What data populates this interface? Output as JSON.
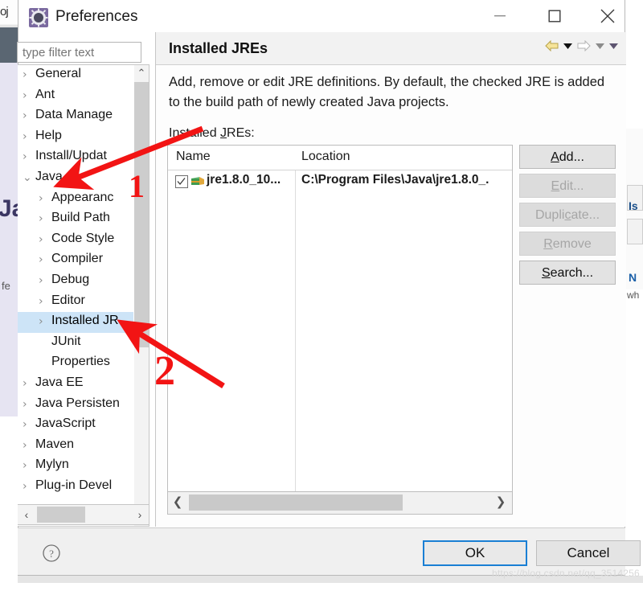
{
  "window": {
    "title": "Preferences",
    "icon": "eclipse-preferences-icon",
    "minimize_label": "Minimize",
    "maximize_label": "Maximize",
    "close_label": "Close"
  },
  "filter": {
    "placeholder": "type filter text",
    "value": ""
  },
  "tree": {
    "items": [
      {
        "label": "General",
        "level": 0,
        "arrow": "›",
        "selected": false
      },
      {
        "label": "Ant",
        "level": 0,
        "arrow": "›",
        "selected": false
      },
      {
        "label": "Data Manage",
        "level": 0,
        "arrow": "›",
        "selected": false
      },
      {
        "label": "Help",
        "level": 0,
        "arrow": "›",
        "selected": false
      },
      {
        "label": "Install/Updat",
        "level": 0,
        "arrow": "›",
        "selected": false
      },
      {
        "label": "Java",
        "level": 0,
        "arrow": "⌄",
        "selected": false
      },
      {
        "label": "Appearanc",
        "level": 1,
        "arrow": "›",
        "selected": false
      },
      {
        "label": "Build Path",
        "level": 1,
        "arrow": "›",
        "selected": false
      },
      {
        "label": "Code Style",
        "level": 1,
        "arrow": "›",
        "selected": false
      },
      {
        "label": "Compiler",
        "level": 1,
        "arrow": "›",
        "selected": false
      },
      {
        "label": "Debug",
        "level": 1,
        "arrow": "›",
        "selected": false
      },
      {
        "label": "Editor",
        "level": 1,
        "arrow": "›",
        "selected": false
      },
      {
        "label": "Installed JR",
        "level": 1,
        "arrow": "›",
        "selected": true
      },
      {
        "label": "JUnit",
        "level": 1,
        "arrow": "",
        "selected": false
      },
      {
        "label": "Properties",
        "level": 1,
        "arrow": "",
        "selected": false
      },
      {
        "label": "Java EE",
        "level": 0,
        "arrow": "›",
        "selected": false
      },
      {
        "label": "Java Persisten",
        "level": 0,
        "arrow": "›",
        "selected": false
      },
      {
        "label": "JavaScript",
        "level": 0,
        "arrow": "›",
        "selected": false
      },
      {
        "label": "Maven",
        "level": 0,
        "arrow": "›",
        "selected": false
      },
      {
        "label": "Mylyn",
        "level": 0,
        "arrow": "›",
        "selected": false
      },
      {
        "label": "Plug-in Devel",
        "level": 0,
        "arrow": "›",
        "selected": false
      }
    ],
    "scroll_up_label": "⌃",
    "scroll_down_label": "⌄",
    "scroll_left_label": "‹",
    "scroll_right_label": "›"
  },
  "page": {
    "title": "Installed JREs",
    "description": "Add, remove or edit JRE definitions. By default, the checked JRE is added to the build path of newly created Java projects.",
    "list_label": "Installed JREs:",
    "nav": {
      "back_icon": "back-arrow-icon",
      "back_menu_icon": "chevron-down-icon",
      "forward_icon": "forward-arrow-icon",
      "forward_menu_icon": "chevron-down-icon",
      "view_menu_icon": "chevron-down-icon"
    }
  },
  "table": {
    "columns": [
      "Name",
      "Location"
    ],
    "rows": [
      {
        "checked": true,
        "icon": "jre-icon",
        "name": "jre1.8.0_10...",
        "location": "C:\\Program Files\\Java\\jre1.8.0_."
      }
    ],
    "scroll_left_label": "❮",
    "scroll_right_label": "❯"
  },
  "side_buttons": [
    {
      "label": "Add...",
      "mnemonic": "A",
      "enabled": true
    },
    {
      "label": "Edit...",
      "mnemonic": "E",
      "enabled": false
    },
    {
      "label": "Duplicate...",
      "mnemonic": "c",
      "enabled": false
    },
    {
      "label": "Remove",
      "mnemonic": "R",
      "enabled": false
    },
    {
      "label": "Search...",
      "mnemonic": "S",
      "enabled": true
    }
  ],
  "footer": {
    "help_icon": "help-question-icon",
    "ok_label": "OK",
    "cancel_label": "Cancel"
  },
  "annotations": {
    "marker_one": "1",
    "marker_two": "2",
    "arrow_one_target": "Java",
    "arrow_two_target": "Installed JRs"
  },
  "watermark": "https://blog.csdn.net/qq_3514256",
  "background": {
    "project_text": "oj",
    "editor_letter": "Ja",
    "fe_text": "fe",
    "right_is": "Is",
    "right_n": "N",
    "right_wh": "wh"
  },
  "colors": {
    "selection": "#cde4f7",
    "accent_blue": "#1a7fd4",
    "annotation_red": "#f21414",
    "titlebar": "#ffffff",
    "panel": "#f0f0f0"
  }
}
